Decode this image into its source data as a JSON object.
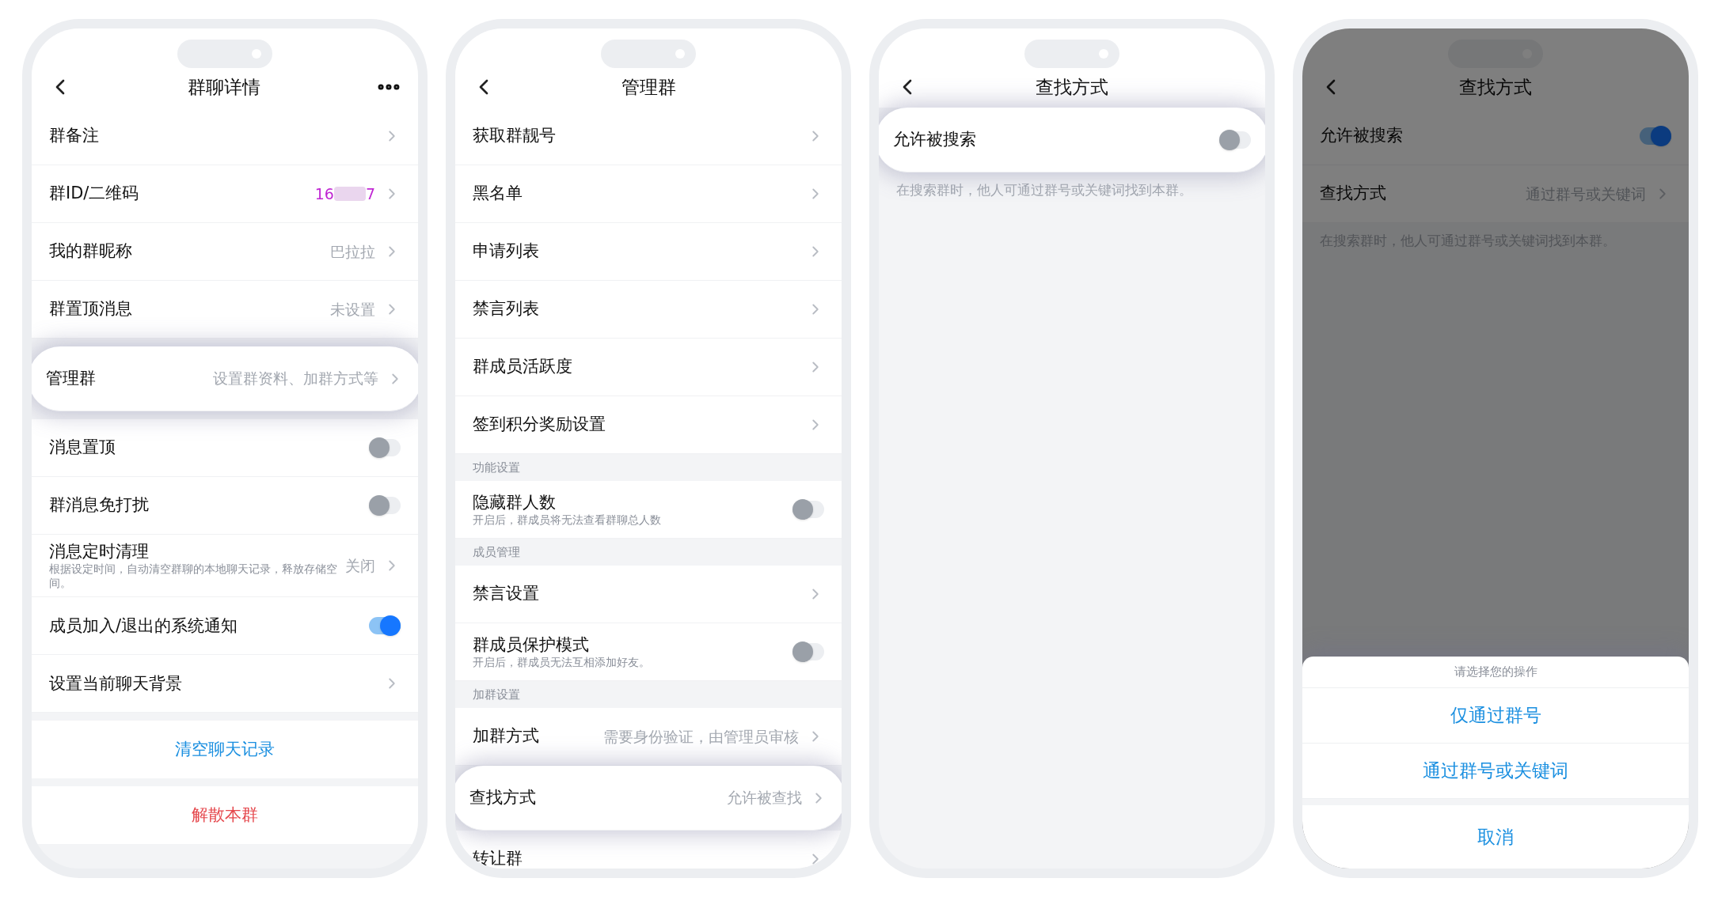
{
  "phones": [
    {
      "title": "群聊详情",
      "more_menu": true,
      "dimmed": false,
      "groups": [
        {
          "rows": [
            {
              "kind": "link",
              "label": "群备注",
              "highlighted": false
            },
            {
              "kind": "link",
              "label": "群ID/二维码",
              "value": "16",
              "value_suffix": "7",
              "color": "#c026d3",
              "highlighted": false
            },
            {
              "kind": "link",
              "label": "我的群昵称",
              "value": "巴拉拉",
              "highlighted": false
            },
            {
              "kind": "link",
              "label": "群置顶消息",
              "value": "未设置",
              "highlighted": false
            }
          ]
        },
        {
          "rows": [
            {
              "kind": "link",
              "label": "管理群",
              "value": "设置群资料、加群方式等",
              "highlighted": true
            }
          ]
        },
        {
          "rows": [
            {
              "kind": "toggle",
              "label": "消息置顶",
              "on": false,
              "highlighted": false
            },
            {
              "kind": "toggle",
              "label": "群消息免打扰",
              "on": false,
              "highlighted": false
            },
            {
              "kind": "link",
              "label": "消息定时清理",
              "subtitle": "根据设定时间，自动清空群聊的本地聊天记录，释放存储空间。",
              "value": "关闭",
              "highlighted": false
            },
            {
              "kind": "toggle",
              "label": "成员加入/退出的系统通知",
              "on": true,
              "highlighted": false
            },
            {
              "kind": "link",
              "label": "设置当前聊天背景",
              "highlighted": false
            }
          ]
        },
        {
          "rows": [
            {
              "kind": "action",
              "label": "清空聊天记录",
              "color": "#1a8fe0",
              "highlighted": false
            }
          ]
        },
        {
          "rows": [
            {
              "kind": "action",
              "label": "解散本群",
              "color": "#e5484d",
              "highlighted": false
            }
          ]
        }
      ]
    },
    {
      "title": "管理群",
      "more_menu": false,
      "dimmed": false,
      "groups": [
        {
          "rows": [
            {
              "kind": "link",
              "label": "获取群靓号",
              "highlighted": false
            },
            {
              "kind": "link",
              "label": "黑名单",
              "highlighted": false
            },
            {
              "kind": "link",
              "label": "申请列表",
              "highlighted": false
            },
            {
              "kind": "link",
              "label": "禁言列表",
              "highlighted": false
            },
            {
              "kind": "link",
              "label": "群成员活跃度",
              "highlighted": false
            },
            {
              "kind": "link",
              "label": "签到积分奖励设置",
              "highlighted": false
            }
          ]
        },
        {
          "header": "功能设置",
          "rows": [
            {
              "kind": "toggle",
              "label": "隐藏群人数",
              "subtitle": "开启后，群成员将无法查看群聊总人数",
              "on": false,
              "highlighted": false
            }
          ]
        },
        {
          "header": "成员管理",
          "rows": [
            {
              "kind": "link",
              "label": "禁言设置",
              "highlighted": false
            },
            {
              "kind": "toggle",
              "label": "群成员保护模式",
              "subtitle": "开启后，群成员无法互相添加好友。",
              "on": false,
              "highlighted": false
            }
          ]
        },
        {
          "header": "加群设置",
          "rows": [
            {
              "kind": "link",
              "label": "加群方式",
              "value": "需要身份验证，由管理员审核",
              "highlighted": false
            },
            {
              "kind": "link",
              "label": "查找方式",
              "value": "允许被查找",
              "highlighted": true
            },
            {
              "kind": "link",
              "label": "转让群",
              "highlighted": false
            }
          ]
        }
      ]
    },
    {
      "title": "查找方式",
      "more_menu": false,
      "dimmed": false,
      "groups": [
        {
          "rows": [
            {
              "kind": "toggle",
              "label": "允许被搜索",
              "on": false,
              "highlighted": true
            }
          ]
        }
      ],
      "note": "在搜索群时，他人可通过群号或关键词找到本群。"
    },
    {
      "title": "查找方式",
      "more_menu": false,
      "dimmed": true,
      "groups": [
        {
          "rows": [
            {
              "kind": "toggle",
              "label": "允许被搜索",
              "on": true,
              "highlighted": false
            },
            {
              "kind": "link",
              "label": "查找方式",
              "value": "通过群号或关键词",
              "highlighted": false
            }
          ]
        }
      ],
      "note": "在搜索群时，他人可通过群号或关键词找到本群。",
      "action_sheet": {
        "title": "请选择您的操作",
        "options": [
          "仅通过群号",
          "通过群号或关键词"
        ],
        "cancel": "取消"
      }
    }
  ]
}
